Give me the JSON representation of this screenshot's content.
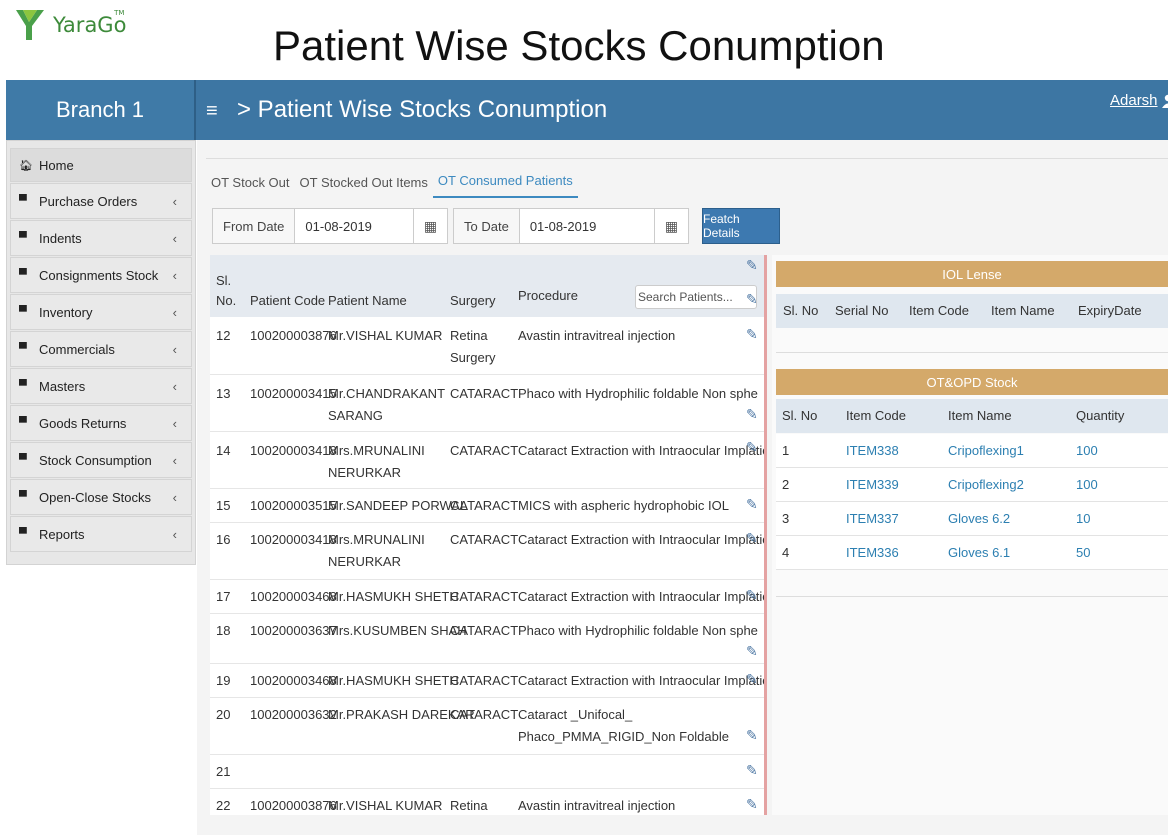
{
  "logo": {
    "text": "YaraGo",
    "tm": "TM"
  },
  "slide_title": "Patient Wise Stocks Conumption",
  "header": {
    "branch": "Branch 1",
    "title": "> Patient Wise Stocks Conumption",
    "user": "Adarsh"
  },
  "sidebar": {
    "items": [
      {
        "label": "Home"
      },
      {
        "label": "Purchase Orders"
      },
      {
        "label": "Indents"
      },
      {
        "label": "Consignments Stock"
      },
      {
        "label": "Inventory"
      },
      {
        "label": "Commercials"
      },
      {
        "label": "Masters"
      },
      {
        "label": "Goods Returns"
      },
      {
        "label": "Stock Consumption"
      },
      {
        "label": "Open-Close Stocks"
      },
      {
        "label": "Reports"
      }
    ]
  },
  "tabs": [
    "OT Stock Out",
    "OT Stocked Out Items",
    "OT Consumed Patients"
  ],
  "filters": {
    "from_label": "From Date",
    "from_value": "01-08-2019",
    "to_label": "To Date",
    "to_value": "01-08-2019",
    "fetch": "Featch Details"
  },
  "patients": {
    "headers": {
      "sl": "Sl.",
      "no": "No.",
      "code": "Patient Code",
      "name": "Patient Name",
      "surgery": "Surgery",
      "procedure": "Procedure"
    },
    "search_placeholder": "Search Patients...",
    "rows": [
      {
        "sl": "12",
        "code": "100200003876",
        "name": "Mr.VISHAL KUMAR",
        "surgery": "Retina Surgery",
        "procedure": "Avastin intravitreal injection"
      },
      {
        "sl": "13",
        "code": "100200003415",
        "name": "Mr.CHANDRAKANT SARANG",
        "surgery": "CATARACT",
        "procedure": "Phaco with Hydrophilic foldable Non spheric IOL"
      },
      {
        "sl": "14",
        "code": "100200003418",
        "name": "Mrs.MRUNALINI NERURKAR",
        "surgery": "CATARACT",
        "procedure": "Cataract Extraction with Intraocular Implation"
      },
      {
        "sl": "15",
        "code": "100200003515",
        "name": "Mr.SANDEEP PORWAL",
        "surgery": "CATARACT",
        "procedure": "MICS with aspheric hydrophobic IOL"
      },
      {
        "sl": "16",
        "code": "100200003418",
        "name": "Mrs.MRUNALINI NERURKAR",
        "surgery": "CATARACT",
        "procedure": "Cataract Extraction with Intraocular Implation"
      },
      {
        "sl": "17",
        "code": "100200003468",
        "name": "Mr.HASMUKH SHETH",
        "surgery": "CATARACT",
        "procedure": "Cataract Extraction with Intraocular Implation"
      },
      {
        "sl": "18",
        "code": "100200003637",
        "name": "Mrs.KUSUMBEN SHAH",
        "surgery": "CATARACT",
        "procedure": "Phaco with Hydrophilic foldable Non spheric IOL"
      },
      {
        "sl": "19",
        "code": "100200003468",
        "name": "Mr.HASMUKH SHETH",
        "surgery": "CATARACT",
        "procedure": "Cataract Extraction with Intraocular Implation"
      },
      {
        "sl": "20",
        "code": "100200003632",
        "name": "Mr.PRAKASH DAREKAR",
        "surgery": "CATARACT",
        "procedure": "Cataract _Unifocal_ Phaco_PMMA_RIGID_Non Foldable"
      },
      {
        "sl": "21",
        "code": "",
        "name": "",
        "surgery": "",
        "procedure": ""
      },
      {
        "sl": "22",
        "code": "100200003876",
        "name": "Mr.VISHAL KUMAR",
        "surgery": "Retina",
        "procedure": "Avastin intravitreal injection"
      }
    ]
  },
  "iol": {
    "title": "IOL Lense",
    "headers": [
      "Sl. No",
      "Serial No",
      "Item Code",
      "Item Name",
      "ExpiryDate"
    ]
  },
  "ot_opd": {
    "title": "OT&OPD Stock",
    "headers": [
      "Sl. No",
      "Item Code",
      "Item Name",
      "Quantity"
    ],
    "rows": [
      {
        "sl": "1",
        "code": "ITEM338",
        "name": "Cripoflexing1",
        "qty": "100"
      },
      {
        "sl": "2",
        "code": "ITEM339",
        "name": "Cripoflexing2",
        "qty": "100"
      },
      {
        "sl": "3",
        "code": "ITEM337",
        "name": "Gloves 6.2",
        "qty": "10"
      },
      {
        "sl": "4",
        "code": "ITEM336",
        "name": "Gloves 6.1",
        "qty": "50"
      }
    ]
  }
}
